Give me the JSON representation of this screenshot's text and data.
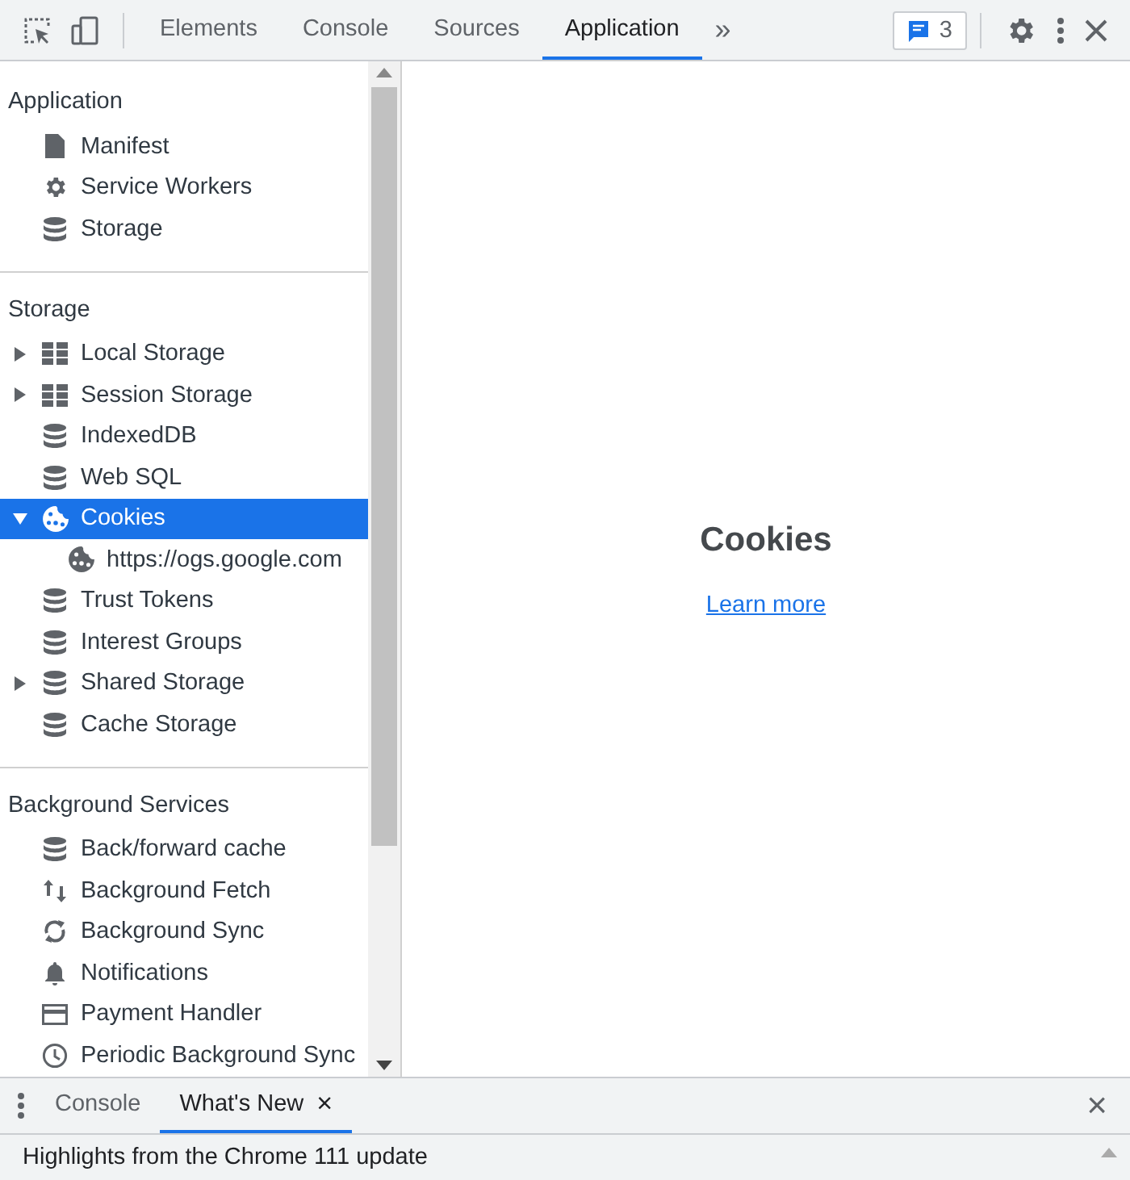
{
  "toolbar": {
    "tabs": [
      {
        "label": "Elements",
        "selected": false
      },
      {
        "label": "Console",
        "selected": false
      },
      {
        "label": "Sources",
        "selected": false
      },
      {
        "label": "Application",
        "selected": true
      }
    ],
    "overflow": "»",
    "issues_count": "3"
  },
  "sidebar": {
    "sections": [
      {
        "title": "Application",
        "items": [
          {
            "label": "Manifest",
            "kind": "file",
            "selected": false
          },
          {
            "label": "Service Workers",
            "kind": "gear",
            "selected": false
          },
          {
            "label": "Storage",
            "kind": "database",
            "selected": false
          }
        ]
      },
      {
        "title": "Storage",
        "items": [
          {
            "label": "Local Storage",
            "kind": "grid",
            "selected": false,
            "expanded": false
          },
          {
            "label": "Session Storage",
            "kind": "grid",
            "selected": false,
            "expanded": false
          },
          {
            "label": "IndexedDB",
            "kind": "database",
            "selected": false
          },
          {
            "label": "Web SQL",
            "kind": "database",
            "selected": false
          },
          {
            "label": "Cookies",
            "kind": "cookie",
            "selected": true,
            "expanded": true,
            "children": [
              {
                "label": "https://ogs.google.com",
                "kind": "cookie",
                "selected": false
              }
            ]
          },
          {
            "label": "Trust Tokens",
            "kind": "database",
            "selected": false
          },
          {
            "label": "Interest Groups",
            "kind": "database",
            "selected": false
          },
          {
            "label": "Shared Storage",
            "kind": "database",
            "selected": false,
            "expanded": false
          },
          {
            "label": "Cache Storage",
            "kind": "database",
            "selected": false
          }
        ]
      },
      {
        "title": "Background Services",
        "items": [
          {
            "label": "Back/forward cache",
            "kind": "database",
            "selected": false
          },
          {
            "label": "Background Fetch",
            "kind": "updown",
            "selected": false
          },
          {
            "label": "Background Sync",
            "kind": "sync",
            "selected": false
          },
          {
            "label": "Notifications",
            "kind": "bell",
            "selected": false
          },
          {
            "label": "Payment Handler",
            "kind": "card",
            "selected": false
          },
          {
            "label": "Periodic Background Sync",
            "kind": "clock",
            "selected": false
          }
        ]
      }
    ]
  },
  "main": {
    "title": "Cookies",
    "link": "Learn more"
  },
  "drawer": {
    "tabs": [
      {
        "label": "Console",
        "selected": false
      },
      {
        "label": "What's New",
        "selected": true
      }
    ],
    "close": "×",
    "tab_close": "×",
    "content": "Highlights from the Chrome 111 update"
  }
}
